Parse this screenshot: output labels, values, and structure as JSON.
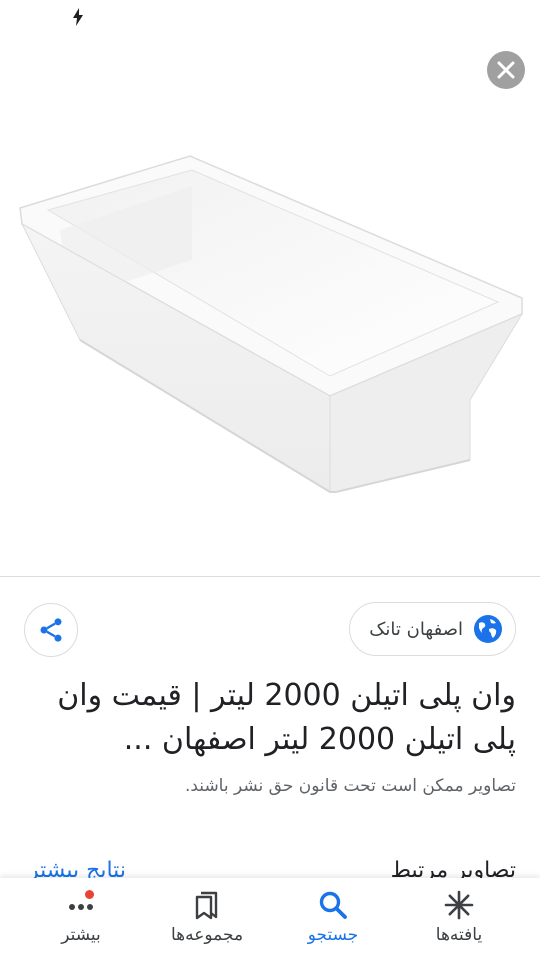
{
  "status_bar": {
    "icons": [
      "bolt-icon"
    ]
  },
  "viewer": {
    "close_icon": "close-icon",
    "image_subject": "white rectangular polyethylene tub"
  },
  "source": {
    "name": "اصفهان تانک",
    "icon": "globe-icon"
  },
  "share": {
    "icon": "share-icon"
  },
  "result": {
    "title": "وان پلی اتیلن 2000 لیتر | قیمت وان پلی اتیلن 2000 لیتر اصفهان ...",
    "copyright_notice": "تصاویر ممکن است تحت قانون حق نشر باشند."
  },
  "related": {
    "title": "تصاویر مرتبط",
    "see_more": "نتایج بیشتر"
  },
  "bottom_nav": {
    "items": [
      {
        "label": "یافته‌ها",
        "icon": "asterisk-icon",
        "active": false
      },
      {
        "label": "جستجو",
        "icon": "search-icon",
        "active": true
      },
      {
        "label": "مجموعه‌ها",
        "icon": "bookmarks-icon",
        "active": false
      },
      {
        "label": "بیشتر",
        "icon": "more-dots-icon",
        "active": false,
        "badge": true
      }
    ]
  },
  "colors": {
    "accent": "#1a73e8",
    "text": "#202124",
    "secondary_text": "#5f6368",
    "badge": "#ea4335",
    "close_button_bg": "#a0a0a0"
  }
}
